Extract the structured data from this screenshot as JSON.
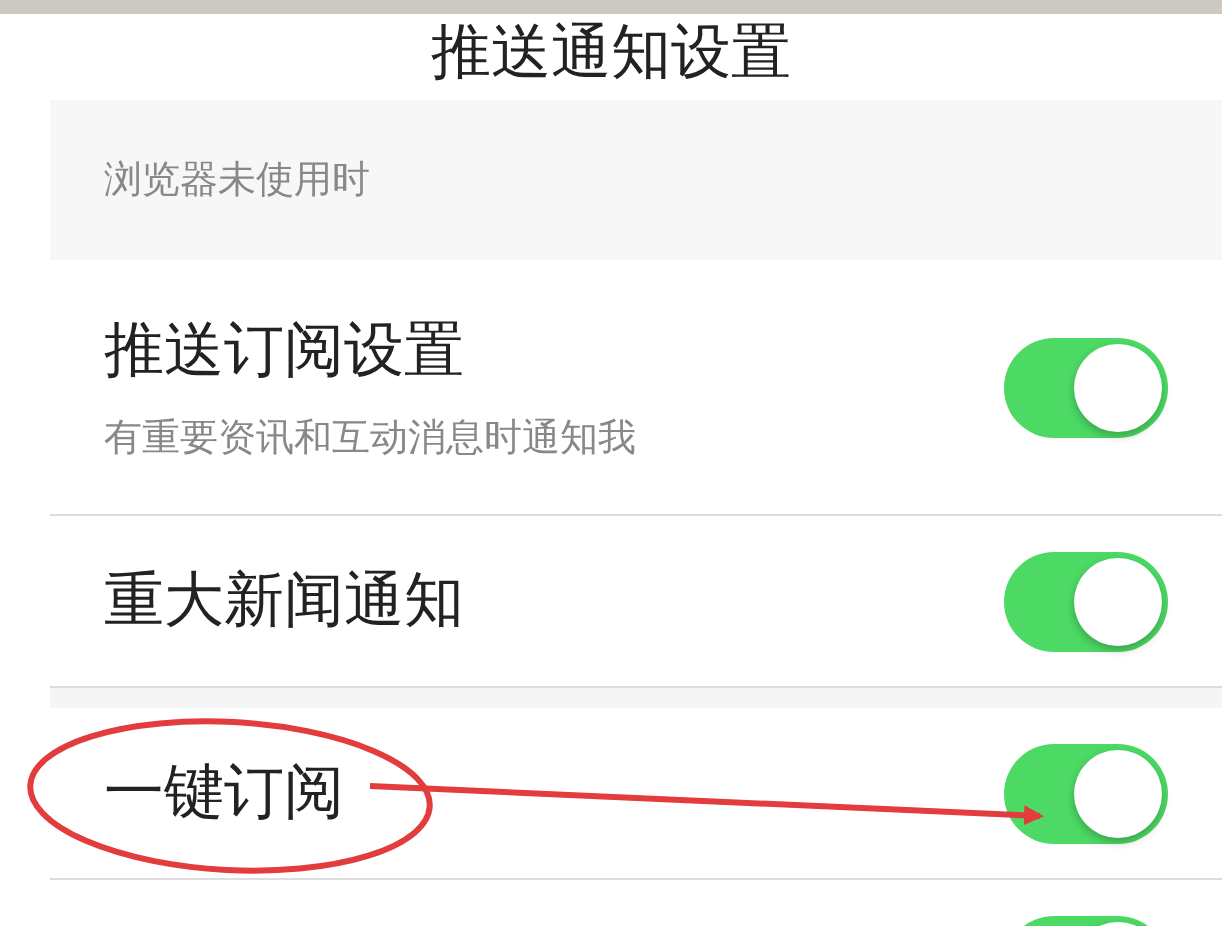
{
  "title": "推送通知设置",
  "section": {
    "header": "浏览器未使用时"
  },
  "groups": [
    {
      "settings": [
        {
          "label": "推送订阅设置",
          "description": "有重要资讯和互动消息时通知我",
          "on": true
        },
        {
          "label": "重大新闻通知",
          "on": true
        }
      ]
    },
    {
      "settings": [
        {
          "label": "一键订阅",
          "on": true
        },
        {
          "on": true
        }
      ]
    }
  ],
  "annotations": {
    "ellipse": true,
    "arrow": true
  }
}
